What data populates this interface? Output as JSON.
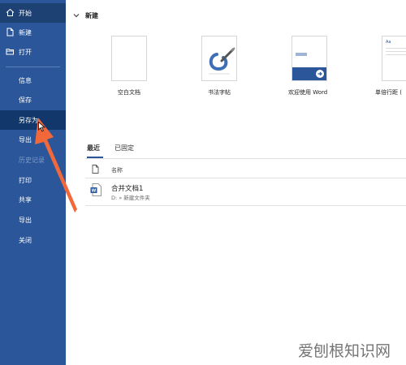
{
  "sidebar": {
    "items": [
      {
        "label": "开始",
        "icon": "home-icon"
      },
      {
        "label": "新建",
        "icon": "new-document-icon"
      },
      {
        "label": "打开",
        "icon": "open-folder-icon"
      },
      {
        "label": "信息"
      },
      {
        "label": "保存"
      },
      {
        "label": "另存为"
      },
      {
        "label": "导出"
      },
      {
        "label": "历史记录"
      },
      {
        "label": "打印"
      },
      {
        "label": "共享"
      },
      {
        "label": "导出"
      },
      {
        "label": "关闭"
      }
    ]
  },
  "main": {
    "new_section_title": "新建",
    "templates": [
      {
        "label": "空白文档"
      },
      {
        "label": "书法字帖"
      },
      {
        "label": "欢迎使用 Word"
      },
      {
        "label": "单倍行距 ("
      }
    ],
    "tabs": [
      {
        "label": "最近"
      },
      {
        "label": "已固定"
      }
    ],
    "column_header": "名称",
    "files": [
      {
        "name": "合并文档1",
        "path": "D: » 新建文件夹"
      }
    ]
  },
  "watermark": "爱刨根知识网",
  "colors": {
    "sidebar": "#2b579a",
    "arrow": "#f2683a",
    "accent": "#2b579a"
  }
}
